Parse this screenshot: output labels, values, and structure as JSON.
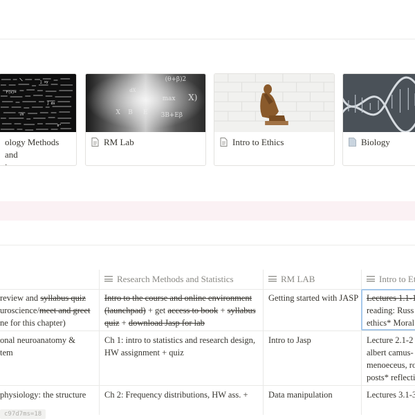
{
  "gallery": {
    "cards": [
      {
        "title": "ology Methods and",
        "subtitle": "ics",
        "cover_icon": "formula-blackboard-image"
      },
      {
        "title": "RM Lab",
        "cover_icon": "math-formula-image"
      },
      {
        "title": "Intro to Ethics",
        "cover_icon": "thinker-statue-image"
      },
      {
        "title": "Biology",
        "cover_icon": "dna-helix-image"
      }
    ]
  },
  "table": {
    "columns": [
      {
        "label": ""
      },
      {
        "label": "Research Methods and Statistics"
      },
      {
        "label": "RM LAB"
      },
      {
        "label": "Intro to Ethi"
      }
    ],
    "rows": [
      {
        "col0": {
          "a": " review and ",
          "b": "syllabus quiz",
          "c": "uroscience/",
          "d": "meet and greet",
          "e": "ne for this chapter)"
        },
        "col1": {
          "a": "Intro to the course and online environment",
          "b": "(launchpad)",
          "c": " + get ",
          "d": "access to book",
          "e": " + ",
          "f": "syllabus",
          "g": "quiz",
          "h": " + ",
          "i": "download Jasp for lab"
        },
        "col2": "Getting started with JASP",
        "col3": {
          "a": "Lectures 1.1-1",
          "b": "reading: Russ",
          "c": "ethics* Moral r"
        }
      },
      {
        "col0": {
          "a": "onal neuroanatomy &",
          "b": "tem"
        },
        "col1": "Ch 1: intro to statistics and research design, HW assignment + quiz",
        "col2": "Intro to Jasp",
        "col3": {
          "a": "Lecture 2.1-2",
          "b": "albert camus-",
          "c": "menoeceus, ro",
          "d": "posts* reflecti"
        }
      },
      {
        "col0": "physiology: the structure",
        "col1": "Ch 2: Frequency distributions, HW ass. +",
        "col2": "Data manipulation",
        "col3": "Lectures 3.1-3"
      }
    ]
  },
  "footer_tag": "c97d7ms=18",
  "colors": {
    "callout_bg": "#fbf1f4",
    "selection_border": "#a6c8ea",
    "text": "#37352f",
    "muted": "#8a8984"
  }
}
